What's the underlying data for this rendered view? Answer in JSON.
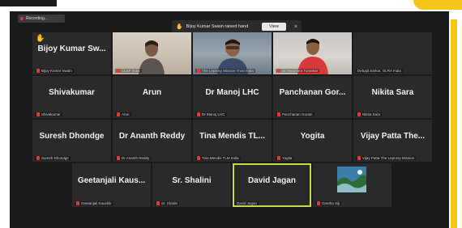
{
  "recording": {
    "label": "Recording..."
  },
  "notification": {
    "text": "Bijoy Kumar Swain raised hand",
    "view_label": "View",
    "close_glyph": "×"
  },
  "tiles_row1": [
    {
      "name": "Bijoy Kumar Sw...",
      "label": "Bijoy Kumar Swain",
      "hand": "✋",
      "muted": true
    },
    {
      "name": "",
      "label": "CLEF India",
      "muted": true,
      "video": "arun"
    },
    {
      "name": "",
      "label": "The Leprosy Mission Trust India",
      "muted": true,
      "video": "manoj"
    },
    {
      "name": "",
      "label": "Dr Panchara Turankar",
      "muted": true,
      "video": "panch"
    },
    {
      "name": "",
      "label": "Debajit Sarkar, GLRA India",
      "muted": false
    }
  ],
  "tiles_row2": [
    {
      "name": "Shivakumar",
      "label": "Shivakumar"
    },
    {
      "name": "Arun",
      "label": "Arun"
    },
    {
      "name": "Dr Manoj LHC",
      "label": "Dr Manoj LHC"
    },
    {
      "name": "Panchanan Gor...",
      "label": "Panchanan Gorain"
    },
    {
      "name": "Nikita Sara",
      "label": "Nikita Sara"
    }
  ],
  "tiles_row3": [
    {
      "name": "Suresh Dhondge",
      "label": "Suresh Dhondge"
    },
    {
      "name": "Dr Ananth Reddy",
      "label": "Dr Ananth Reddy"
    },
    {
      "name": "Tina Mendis TL...",
      "label": "Tina Mendis TLM India"
    },
    {
      "name": "Yogita",
      "label": "Yogita"
    },
    {
      "name": "Vijay Patta The...",
      "label": "Vijay Patta The Leprosy Mission"
    }
  ],
  "tiles_row4": [
    {
      "name": "Geetanjali Kaus...",
      "label": "Geetanjali Kaushik",
      "muted": true
    },
    {
      "name": "Sr. Shalini",
      "label": "Sr. Shalini",
      "muted": true
    },
    {
      "name": "David Jagan",
      "label": "David Jagan",
      "muted": false,
      "active": true
    },
    {
      "name": "",
      "label": "Geetha Siji",
      "muted": true,
      "video": "geetha"
    }
  ],
  "colors": {
    "accent_yellow": "#f5c518",
    "active_border": "#c3d94e",
    "tile_bg": "#2a2a2a",
    "mic_muted": "#e53935"
  }
}
